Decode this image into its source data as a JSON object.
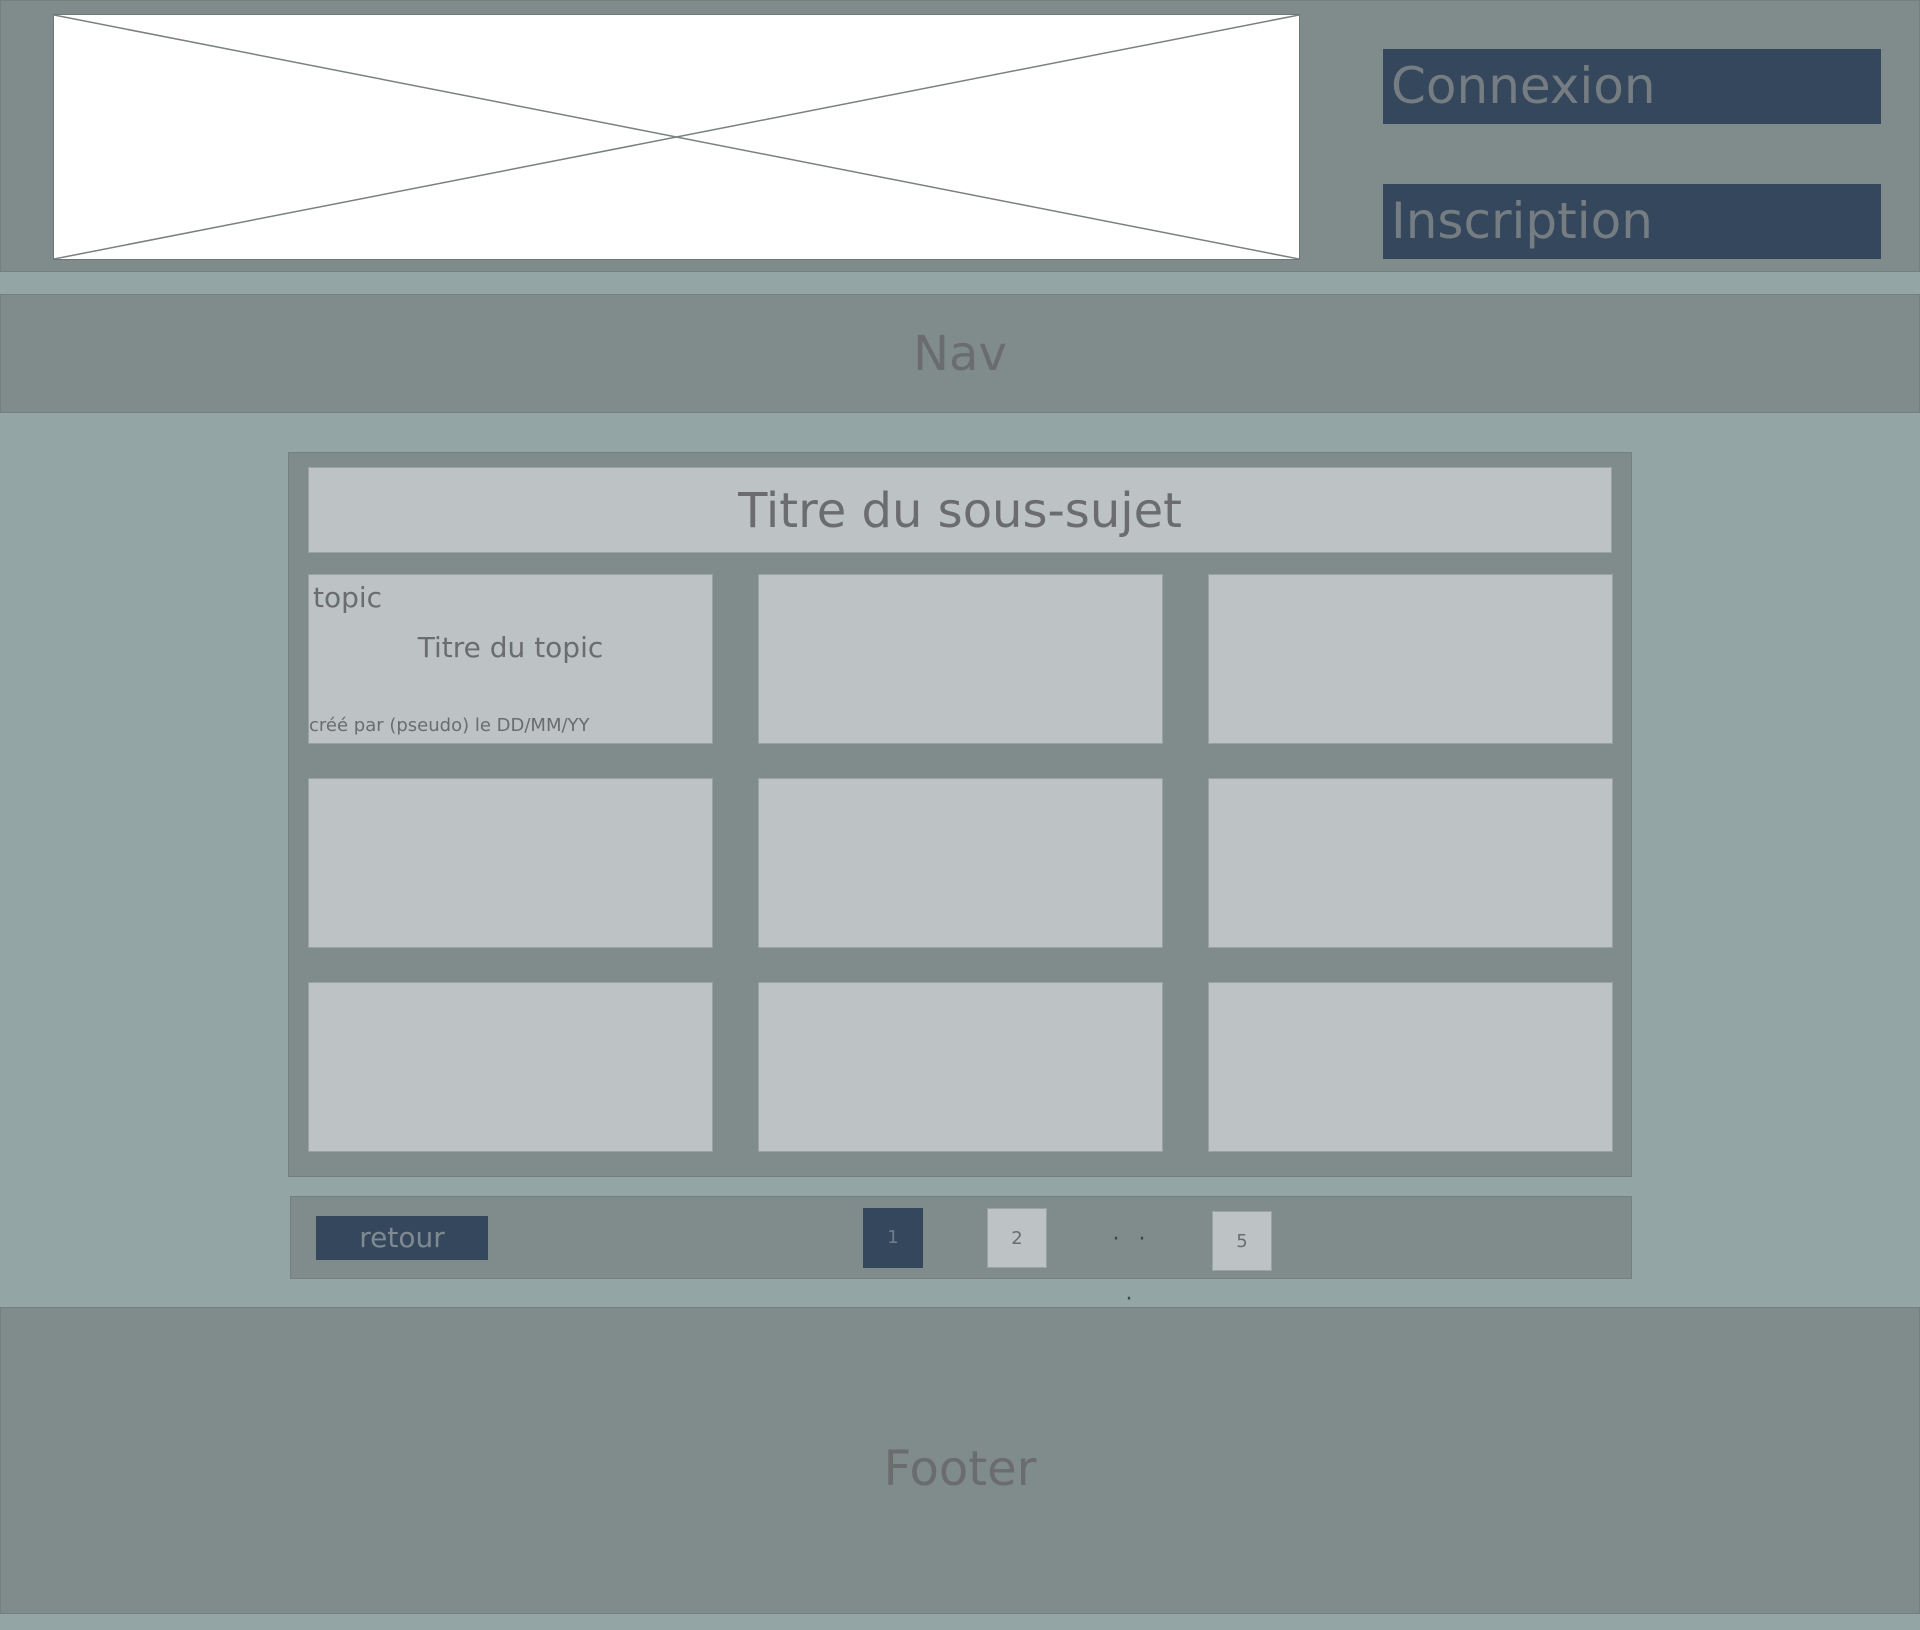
{
  "header": {
    "buttons": {
      "login": "Connexion",
      "register": "Inscription"
    }
  },
  "nav": {
    "label": "Nav"
  },
  "main": {
    "subject_title": "Titre du sous-sujet",
    "topics": [
      {
        "type_label": "topic",
        "title": "Titre du topic",
        "meta": "créé par (pseudo) le DD/MM/YY"
      }
    ]
  },
  "pagination": {
    "back_label": "retour",
    "pages": [
      "1",
      "2",
      "5"
    ],
    "current_page": "1",
    "ellipsis": "· · ·"
  },
  "footer": {
    "label": "Footer"
  },
  "colors": {
    "band_background": "#7f8c8b",
    "page_background": "#93a5a5",
    "card_background": "#bdc2c5",
    "button_background": "#34475c",
    "text": "#6a6c6d"
  }
}
